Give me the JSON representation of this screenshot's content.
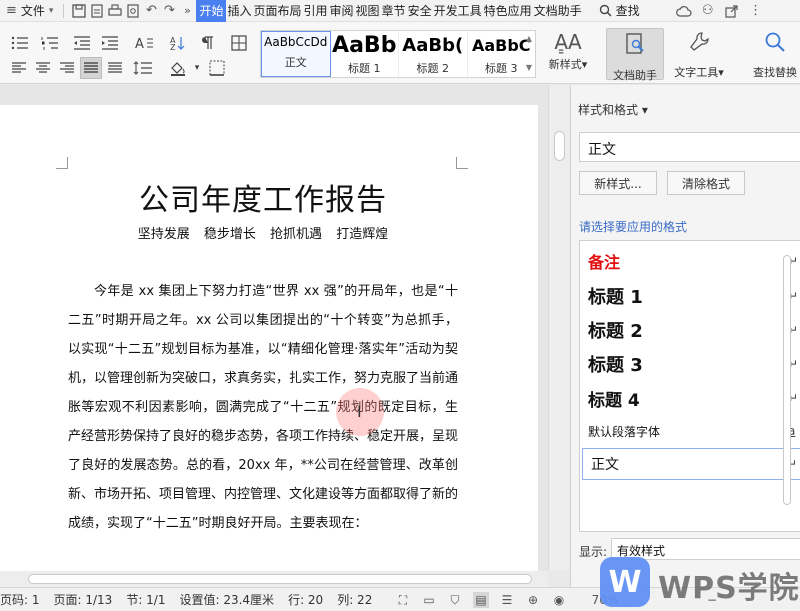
{
  "menubar": {
    "file": "文件",
    "tabs": [
      "开始",
      "插入",
      "页面布局",
      "引用",
      "审阅",
      "视图",
      "章节",
      "安全",
      "开发工具",
      "特色应用",
      "文档助手"
    ],
    "active_tab": "开始",
    "search": "查找"
  },
  "ribbon": {
    "styles": [
      {
        "preview": "AaBbCcDd",
        "label": "正文"
      },
      {
        "preview": "AaBb",
        "label": "标题 1"
      },
      {
        "preview": "AaBb(",
        "label": "标题 2"
      },
      {
        "preview": "AaBbC",
        "label": "标题 3"
      }
    ],
    "new_style": "新样式",
    "doc_assistant": "文档助手",
    "text_tools": "文字工具",
    "find_replace": "查找替换"
  },
  "document": {
    "title": "公司年度工作报告",
    "subtitle": "坚持发展 稳步增长 抢抓机遇 打造辉煌",
    "body": "今年是 xx 集团上下努力打造“世界 xx 强”的开局年，也是“十二五”时期开局之年。xx 公司以集团提出的“十个转变”为总抓手，以实现“十二五”规划目标为基准，以“精细化管理·落实年”活动为契机，以管理创新为突破口，求真务实，扎实工作，努力克服了当前通胀等宏观不利因素影响，圆满完成了“十二五”规划的既定目标，生产经营形势保持了良好的稳步态势，各项工作持续、稳定开展，呈现了良好的发展态势。总的看，20xx 年，**公司在经营管理、改革创新、市场开拓、项目管理、内控管理、文化建设等方面都取得了新的成绩，实现了“十二五”时期良好开局。主要表现在："
  },
  "pane": {
    "title": "样式和格式",
    "current_style": "正文",
    "new_style_btn": "新样式...",
    "clear_format_btn": "清除格式",
    "choose_label": "请选择要应用的格式",
    "items": [
      {
        "label": "备注",
        "mark": "↵",
        "color": "#e01010"
      },
      {
        "label": "标题 1",
        "mark": "↵"
      },
      {
        "label": "标题 2",
        "mark": "↵"
      },
      {
        "label": "标题 3",
        "mark": "↵"
      },
      {
        "label": "标题 4",
        "mark": "↵"
      },
      {
        "label": "默认段落字体",
        "mark": "a"
      },
      {
        "label": "正文",
        "mark": "↵"
      }
    ],
    "show_label": "显示:",
    "show_value": "有效样式"
  },
  "statusbar": {
    "page_num": "页码: 1",
    "page": "页面: 1/13",
    "section": "节: 1/1",
    "setting": "设置值: 23.4厘米",
    "row": "行: 20",
    "col": "列: 22",
    "zoom": "70%"
  },
  "watermark": {
    "logo_letter": "W",
    "text": "WPS学院"
  }
}
